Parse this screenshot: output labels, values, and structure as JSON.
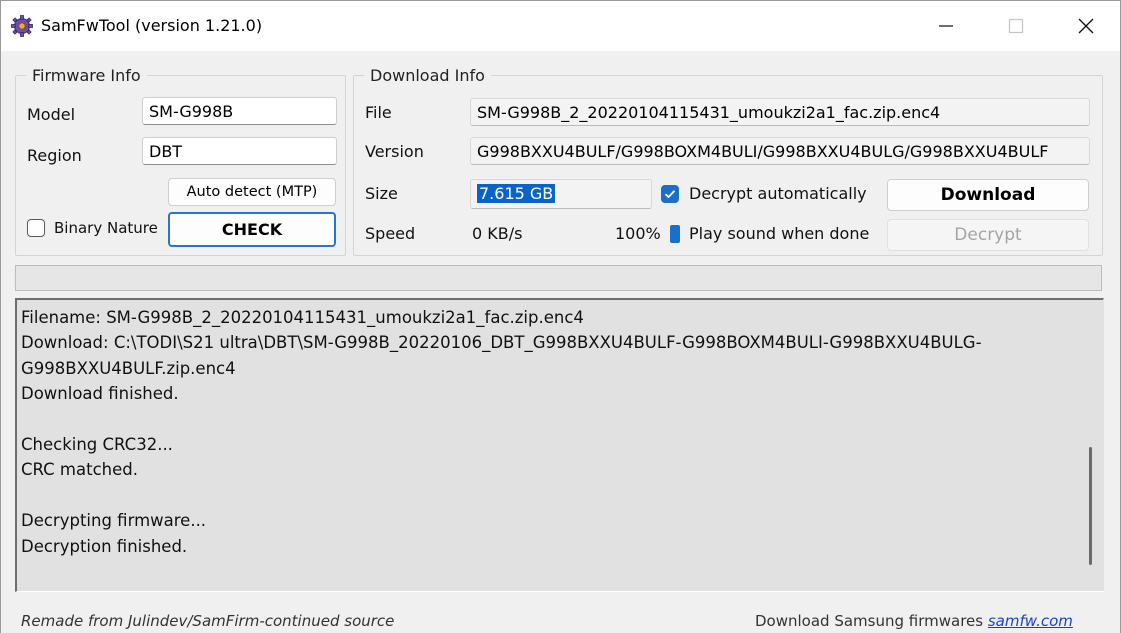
{
  "window": {
    "title": "SamFwTool (version 1.21.0)",
    "icon": "gear-app-icon",
    "controls": [
      "minimize-icon",
      "maximize-icon",
      "close-icon"
    ]
  },
  "firmware_info": {
    "legend": "Firmware Info",
    "model_label": "Model",
    "model_value": "SM-G998B",
    "region_label": "Region",
    "region_value": "DBT",
    "auto_detect_label": "Auto detect (MTP)",
    "binary_nature_label": "Binary Nature",
    "binary_nature_checked": false,
    "check_label": "CHECK"
  },
  "download_info": {
    "legend": "Download Info",
    "file_label": "File",
    "file_value": "SM-G998B_2_20220104115431_umoukzi2a1_fac.zip.enc4",
    "version_label": "Version",
    "version_value": "G998BXXU4BULF/G998BOXM4BULI/G998BXXU4BULG/G998BXXU4BULF",
    "size_label": "Size",
    "size_value": "7.615 GB",
    "decrypt_auto_label": "Decrypt automatically",
    "decrypt_auto_checked": true,
    "download_label": "Download",
    "speed_label": "Speed",
    "speed_value": "0 KB/s",
    "percent_value": "100%",
    "play_sound_label": "Play sound when done",
    "play_sound_checked": true,
    "decrypt_label": "Decrypt"
  },
  "progress": {
    "fraction": 0
  },
  "log": {
    "lines": [
      "Filename: SM-G998B_2_20220104115431_umoukzi2a1_fac.zip.enc4",
      "Download: C:\\TODI\\S21 ultra\\DBT\\SM-G998B_20220106_DBT_G998BXXU4BULF-G998BOXM4BULI-G998BXXU4BULG-",
      "G998BXXU4BULF.zip.enc4",
      "Download finished.",
      "",
      "Checking CRC32...",
      "CRC matched.",
      "",
      "Decrypting firmware...",
      "Decryption finished."
    ]
  },
  "footer": {
    "left_text": "Remade from Julindev/SamFirm-continued source",
    "right_text": "Download Samsung firmwares",
    "link_text": "samfw.com"
  },
  "colors": {
    "accent": "#1a6fc9",
    "selection": "#0a64c8",
    "link": "#1a3fd0",
    "check_border": "#2a74d0"
  }
}
